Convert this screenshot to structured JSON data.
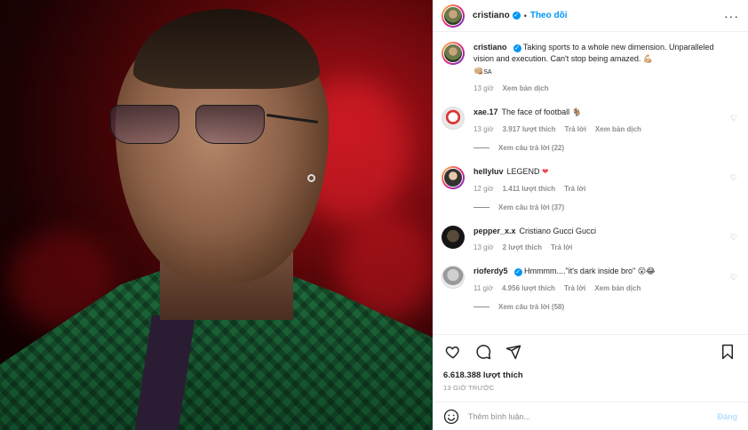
{
  "post": {
    "username": "cristiano",
    "separator": "•",
    "follow_label": "Theo dõi",
    "more_icon": "more-horizontal-icon"
  },
  "caption": {
    "username": "cristiano",
    "text": "Taking sports to a whole new dimension. Unparalleled vision and execution. Can't stop being amazed.",
    "emoji_1": "💪🏼",
    "emoji_2": "👊🏼",
    "tag": "SA",
    "time": "13 giờ",
    "translate": "Xem bản dịch"
  },
  "comments": [
    {
      "username": "xae.17",
      "verified": false,
      "text": "The face of football",
      "emoji": "🐐",
      "time": "13 giờ",
      "likes": "3.917 lượt thích",
      "reply": "Trả lời",
      "translate": "Xem bản dịch",
      "replies": "Xem câu trả lời (22)"
    },
    {
      "username": "hellyluv",
      "verified": true,
      "text": "LEGEND",
      "emoji": "❤",
      "time": "12 giờ",
      "likes": "1.411 lượt thích",
      "reply": "Trả lời",
      "translate": "",
      "replies": "Xem câu trả lời (37)"
    },
    {
      "username": "pepper_x.x",
      "verified": false,
      "text": "Cristiano Gucci Gucci",
      "emoji": "",
      "time": "13 giờ",
      "likes": "2 lượt thích",
      "reply": "Trả lời",
      "translate": "",
      "replies": ""
    },
    {
      "username": "rioferdy5",
      "verified": true,
      "text": "Hmmmm....\"it's dark inside bro\"",
      "emoji": "😮😂",
      "time": "11 giờ",
      "likes": "4.956 lượt thích",
      "reply": "Trả lời",
      "translate": "Xem bản dịch",
      "replies": "Xem câu trả lời (58)"
    }
  ],
  "actions": {
    "like_icon": "heart-icon",
    "comment_icon": "comment-icon",
    "share_icon": "send-icon",
    "save_icon": "bookmark-icon",
    "likes": "6.618.388 lượt thích",
    "time": "13 GIỜ TRƯỚC"
  },
  "add_comment": {
    "placeholder": "Thêm bình luận...",
    "post_label": "Đăng"
  },
  "colors": {
    "accent": "#0095f6",
    "heart_red": "#ed4956",
    "muted": "#8e8e8e"
  }
}
